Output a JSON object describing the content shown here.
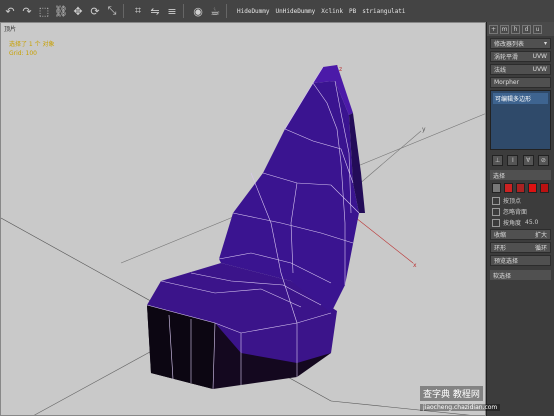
{
  "toolbar": {
    "icons": [
      "undo-icon",
      "redo-icon",
      "select-icon",
      "link-icon",
      "move-icon",
      "rotate-icon",
      "scale-icon",
      "snap-icon",
      "mirror-icon",
      "align-icon",
      "render-icon",
      "teapot-icon"
    ],
    "buttons": [
      {
        "label": "HideDummy"
      },
      {
        "label": "UnHideDummy"
      },
      {
        "label": "Xclink"
      },
      {
        "label": "PB"
      },
      {
        "label": "striangulati"
      }
    ]
  },
  "viewport": {
    "label": "顶片",
    "selection_info": "选择了 1 个 对象",
    "grid_info": "Grid: 100",
    "axes": {
      "x": "x",
      "y": "y",
      "z": "z"
    }
  },
  "panel": {
    "tabs": [
      "+",
      "m",
      "h",
      "d",
      "u"
    ],
    "object_name": "修改器列表",
    "rows": [
      {
        "label": "涡轮平滑",
        "value": "UVW"
      },
      {
        "label": "法线",
        "value": "UVW"
      },
      {
        "label": "Morpher",
        "value": ""
      }
    ],
    "stack_item": "可编辑多边形",
    "section_select": "选择",
    "checks": [
      "按顶点",
      "忽略背面",
      "按角度"
    ],
    "checks_value": "45.0",
    "shrink_label": "收缩",
    "grow_label": "扩大",
    "ring_label": "环形",
    "loop_label": "循环",
    "preview_label": "预览选择",
    "soft_select": "软选择"
  },
  "watermark": {
    "site": "查字典 教程网",
    "url": "jiaocheng.chazidian.com"
  }
}
